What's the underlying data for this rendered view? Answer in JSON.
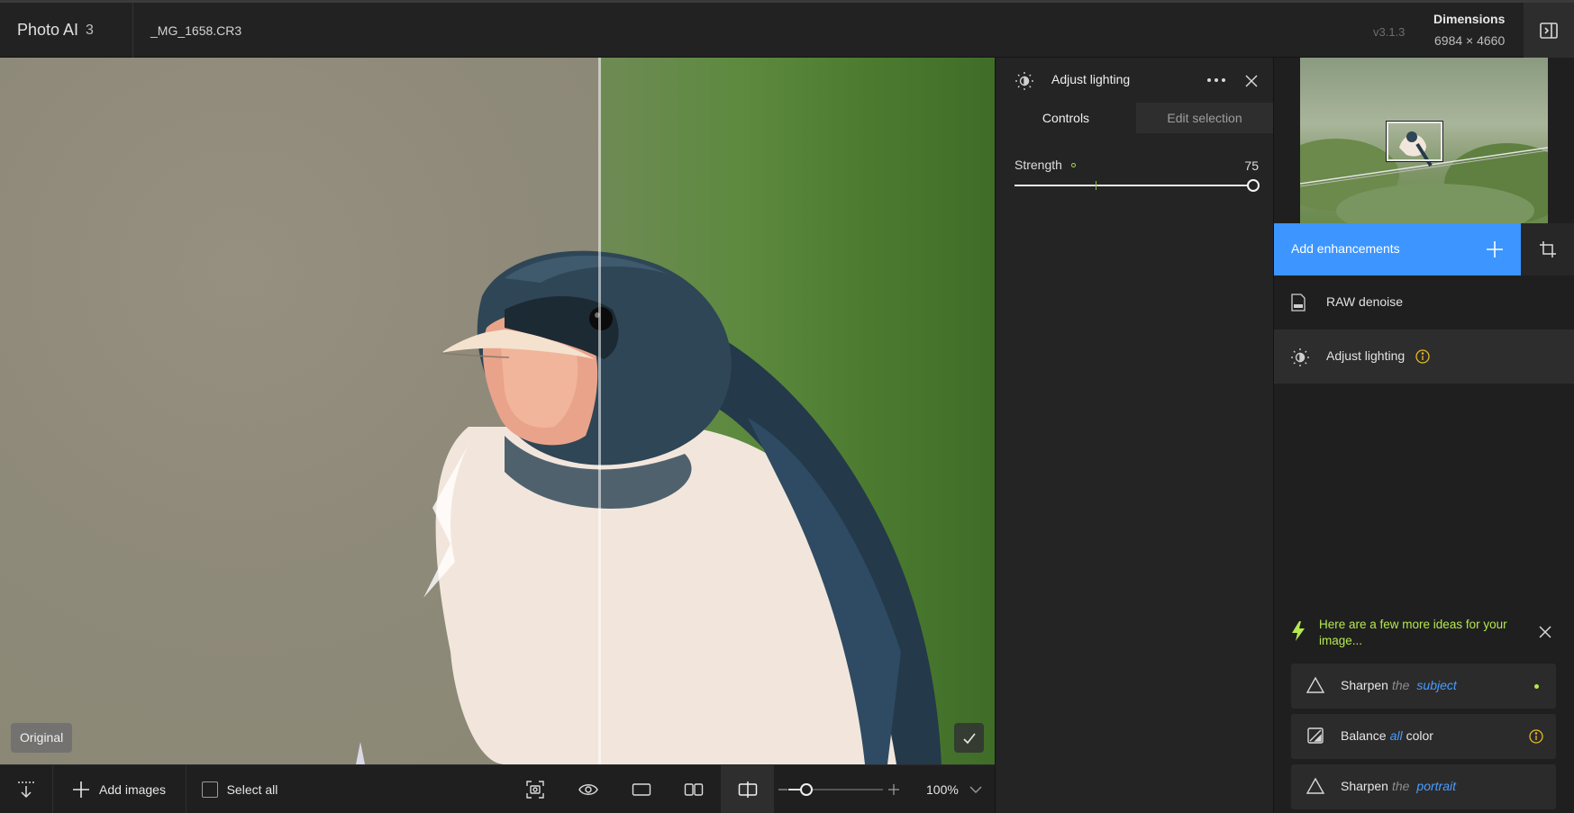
{
  "topbar": {
    "app_name": "Photo AI",
    "app_version_badge": "3",
    "file_name": "_MG_1658.CR3",
    "app_build": "v3.1.3",
    "dimensions_label": "Dimensions",
    "dimensions_value": "6984 × 4660"
  },
  "canvas": {
    "original_badge": "Original"
  },
  "bottombar": {
    "add_images_label": "Add images",
    "select_all_label": "Select all",
    "zoom_level": "100%",
    "zoom_slider_fraction": 0.2
  },
  "adjust_panel": {
    "title": "Adjust lighting",
    "tabs": [
      {
        "label": "Controls",
        "active": true
      },
      {
        "label": "Edit selection",
        "active": false
      }
    ],
    "strength_label": "Strength",
    "strength_value": "75"
  },
  "sidebar": {
    "add_enhancements_label": "Add enhancements",
    "enhancements": [
      {
        "label": "RAW denoise",
        "icon": "raw-file-icon"
      },
      {
        "label": "Adjust lighting",
        "icon": "lighting-icon",
        "selected": true
      }
    ],
    "ideas_title": "Here are a few more ideas for your image...",
    "ideas": [
      {
        "verb": "Sharpen",
        "qualifier": "the",
        "highlight": "subject",
        "after": "",
        "icon": "triangle-icon",
        "status": "green-dot"
      },
      {
        "verb": "Balance",
        "qualifier": "",
        "highlight": "all",
        "after": "color",
        "icon": "balance-icon",
        "status": "info-icon"
      },
      {
        "verb": "Sharpen",
        "qualifier": "the",
        "highlight": "portrait",
        "after": "",
        "icon": "triangle-icon",
        "status": ""
      }
    ]
  },
  "colors": {
    "accent_blue": "#3d95ff",
    "idea_green": "#b4e84f",
    "warning_yellow": "#e8b923"
  }
}
